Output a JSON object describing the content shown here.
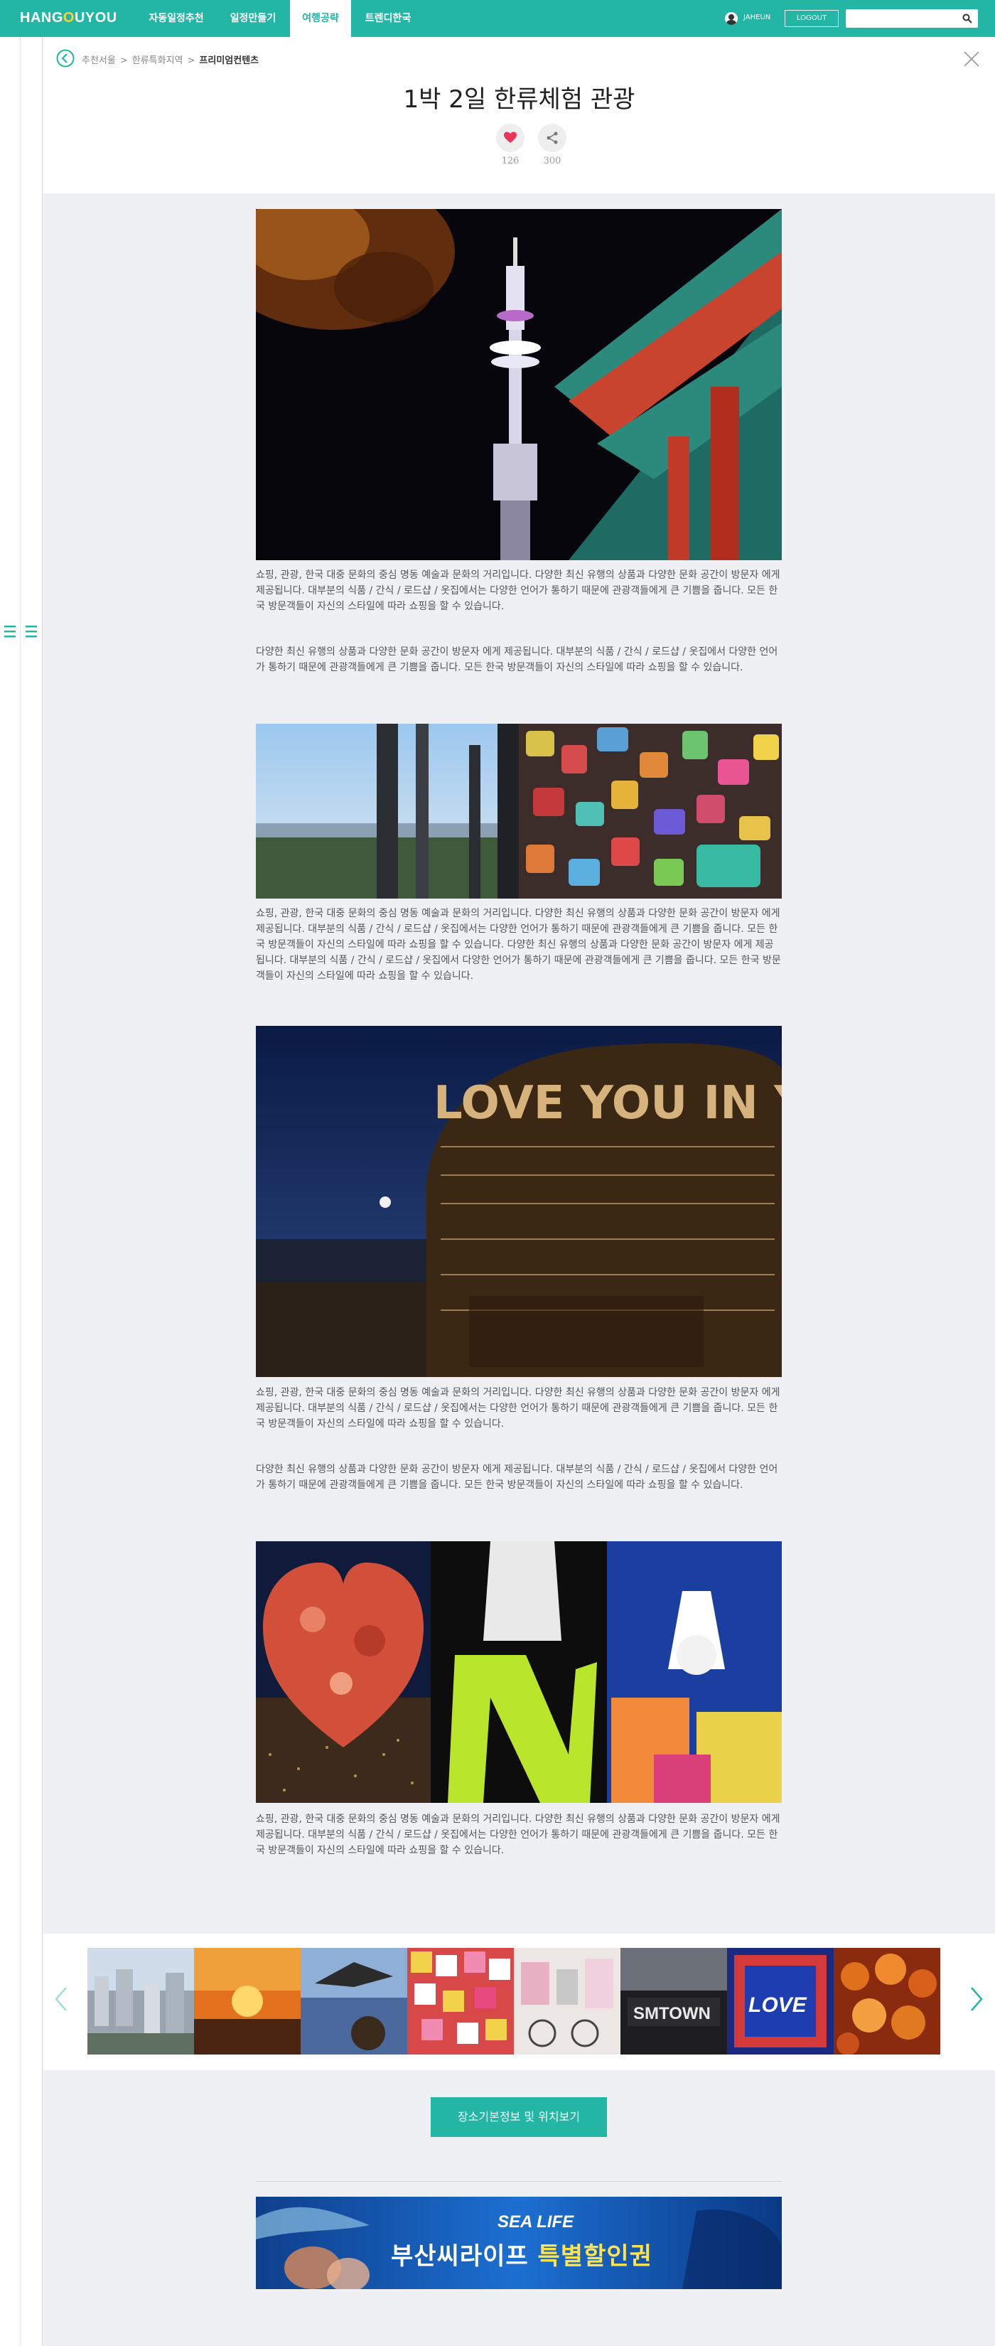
{
  "nav": {
    "logo_part1": "HANG",
    "logo_o": "O",
    "logo_part2": "UYOU",
    "tabs": [
      {
        "label": "자동일정추천"
      },
      {
        "label": "일정만들기"
      },
      {
        "label": "여행공략"
      },
      {
        "label": "트렌디한국"
      }
    ],
    "active_tab": "여행공략",
    "user_name": "JAHEUN",
    "logout_label": "LOGOUT",
    "search_placeholder": ""
  },
  "breadcrumb": {
    "items": [
      "추천서울",
      "한류특화지역",
      "프리미엄컨텐츠"
    ]
  },
  "title": "1박 2일 한류체험 관광",
  "stats": {
    "likes": "126",
    "shares": "300"
  },
  "paragraphs": [
    "쇼핑, 관광, 한국 대중 문화의 중심 명동 예술과 문화의 거리입니다. 다양한 최신 유행의 상품과 다양한 문화 공간이 방문자 에게 제공됩니다. 대부분의 식품 / 간식 / 로드샵 / 옷집에서는 다양한 언어가 통하기 때문에 관광객들에게 큰 기쁨을 줍니다. 모든 한국 방문객들이 자신의 스타일에 따라 쇼핑을 할 수 있습니다.",
    "다양한 최신 유행의 상품과 다양한 문화 공간이 방문자 에게 제공됩니다. 대부분의 식품 / 간식 / 로드샵 / 옷집에서 다양한 언어가 통하기 때문에 관광객들에게 큰 기쁨을 줍니다. 모든 한국 방문객들이 자신의 스타일에 따라 쇼핑을 할 수 있습니다.",
    "쇼핑, 관광, 한국 대중 문화의 중심 명동 예술과 문화의 거리입니다. 다양한 최신 유행의 상품과 다양한 문화 공간이 방문자 에게 제공됩니다. 대부분의 식품 / 간식 / 로드샵 / 옷집에서는 다양한 언어가 통하기 때문에 관광객들에게 큰 기쁨을 줍니다. 모든 한국 방문객들이 자신의 스타일에 따라 쇼핑을 할 수 있습니다. 다양한 최신 유행의 상품과 다양한 문화 공간이 방문자 에게 제공됩니다. 대부분의 식품 / 간식 / 로드샵 / 옷집에서 다양한 언어가 통하기 때문에 관광객들에게 큰 기쁨을 줍니다. 모든 한국 방문객들이 자신의 스타일에 따라 쇼핑을 할 수 있습니다.",
    "쇼핑, 관광, 한국 대중 문화의 중심 명동 예술과 문화의 거리입니다. 다양한 최신 유행의 상품과 다양한 문화 공간이 방문자 에게 제공됩니다. 대부분의 식품 / 간식 / 로드샵 / 옷집에서는 다양한 언어가 통하기 때문에 관광객들에게 큰 기쁨을 줍니다. 모든 한국 방문객들이 자신의 스타일에 따라 쇼핑을 할 수 있습니다.",
    "다양한 최신 유행의 상품과 다양한 문화 공간이 방문자 에게 제공됩니다. 대부분의 식품 / 간식 / 로드샵 / 옷집에서 다양한 언어가 통하기 때문에 관광객들에게 큰 기쁨을 줍니다. 모든 한국 방문객들이 자신의 스타일에 따라 쇼핑을 할 수 있습니다.",
    "쇼핑, 관광, 한국 대중 문화의 중심 명동 예술과 문화의 거리입니다. 다양한 최신 유행의 상품과 다양한 문화 공간이 방문자 에게 제공됩니다. 대부분의 식품 / 간식 / 로드샵 / 옷집에서는 다양한 언어가 통하기 때문에 관광객들에게 큰 기쁨을 줍니다. 모든 한국 방문객들이 자신의 스타일에 따라 쇼핑을 할 수 있습니다."
  ],
  "photo3_text": "LOVE YOU IN YOUR LOVE WHEN WE SEOUL IN LOVE WITH YOU",
  "location_button": "장소기본정보 및 위치보기",
  "banner": {
    "logo": "SEA LIFE",
    "text_part1": "부산씨라이프",
    "text_part2": "특별할인권"
  },
  "colors": {
    "accent": "#24b6a4",
    "like": "#e8365c"
  }
}
